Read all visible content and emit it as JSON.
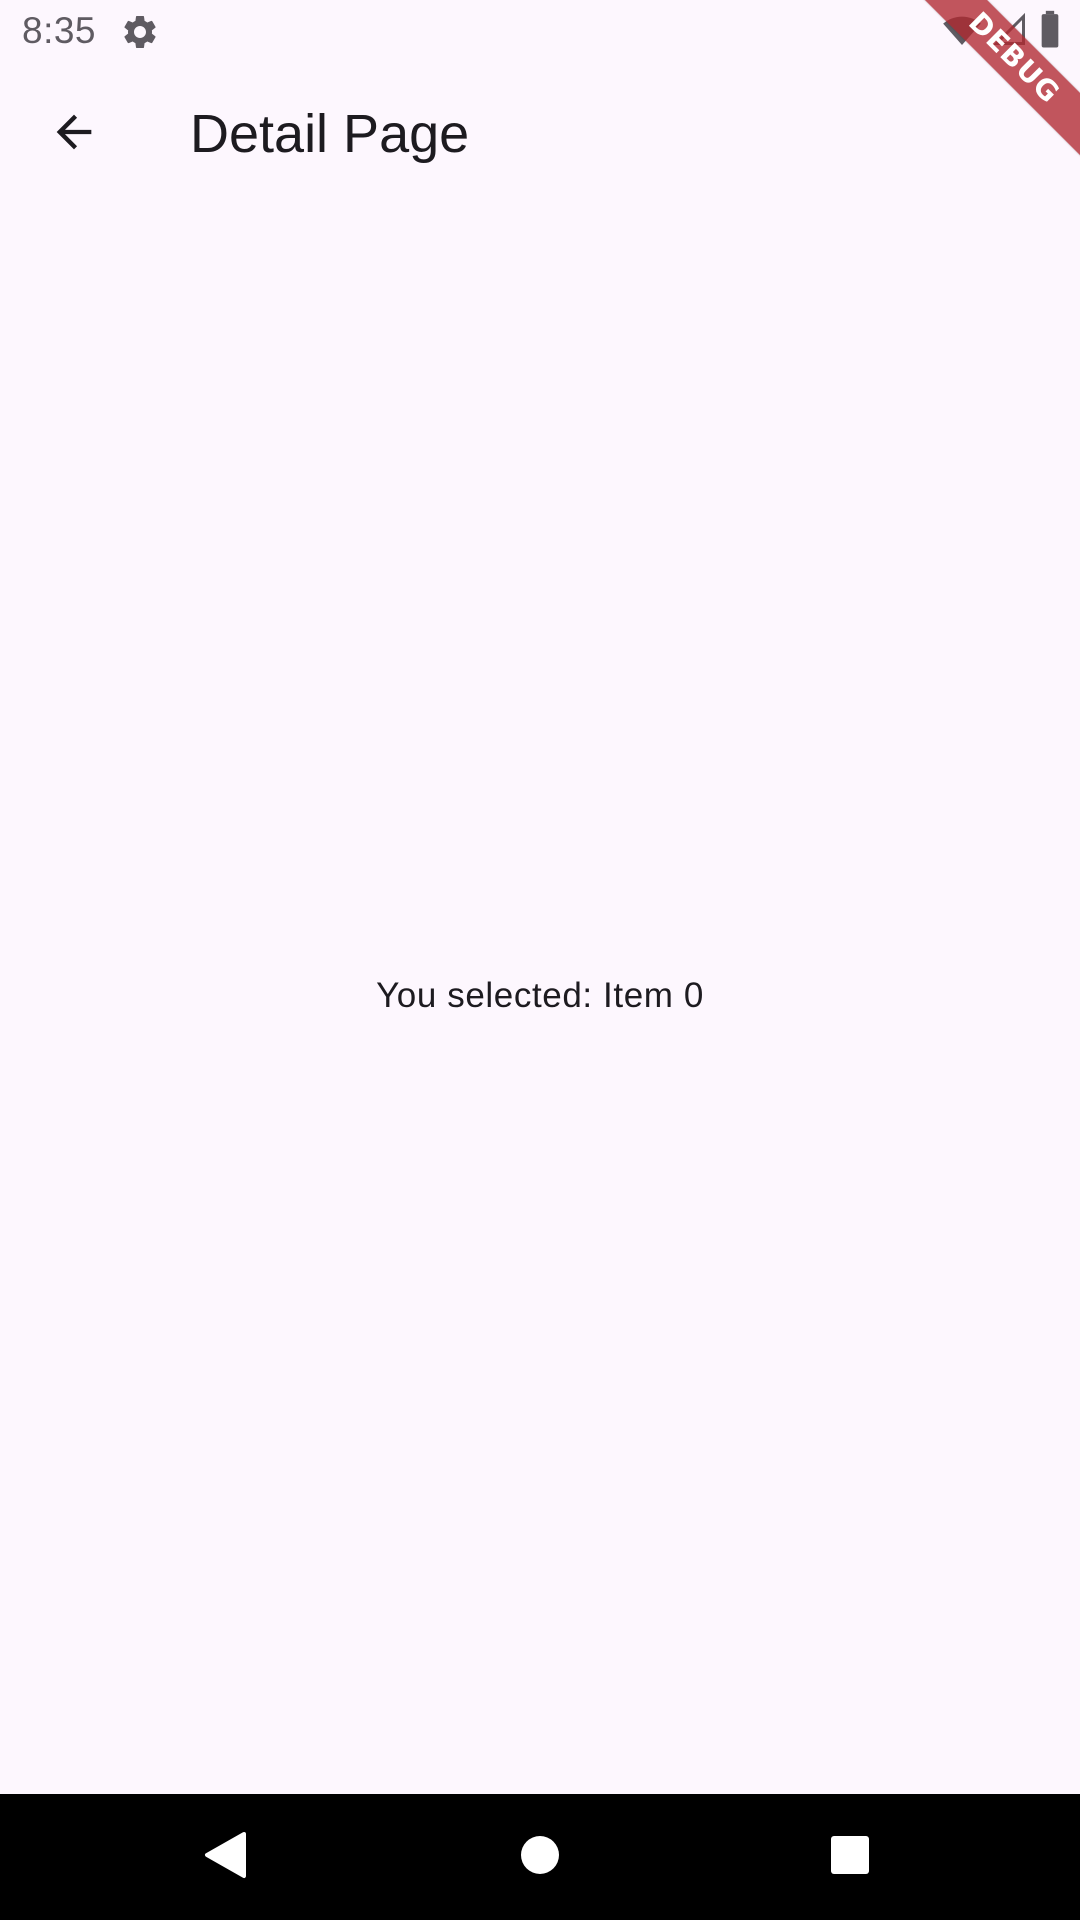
{
  "status_bar": {
    "time": "8:35",
    "icons": [
      "gear-icon",
      "wifi-icon",
      "signal-icon",
      "battery-icon"
    ],
    "icon_color": "#5f5b62"
  },
  "app_bar": {
    "title": "Detail Page",
    "back_icon": "arrow-back-icon"
  },
  "body": {
    "message": "You selected: Item 0"
  },
  "debug_banner": {
    "label": "DEBUG",
    "color": "#b02830"
  },
  "nav_bar": {
    "buttons": [
      "back-triangle-icon",
      "home-circle-icon",
      "recents-square-icon"
    ]
  },
  "colors": {
    "background": "#fdf7fe",
    "text": "#1d1b20",
    "nav_background": "#000000"
  }
}
